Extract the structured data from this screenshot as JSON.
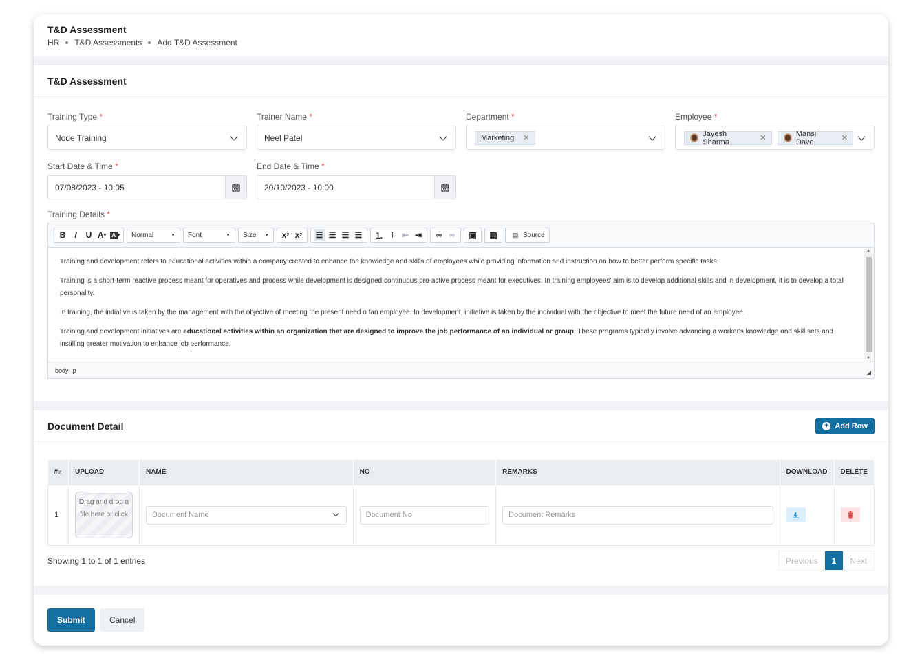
{
  "header": {
    "title": "T&D Assessment",
    "breadcrumb": [
      "HR",
      "T&D Assessments",
      "Add T&D Assessment"
    ]
  },
  "assessment": {
    "title": "T&D Assessment",
    "training_type": {
      "label": "Training Type",
      "value": "Node Training"
    },
    "trainer_name": {
      "label": "Trainer Name",
      "value": "Neel Patel"
    },
    "department": {
      "label": "Department",
      "tags": [
        "Marketing"
      ]
    },
    "employee": {
      "label": "Employee",
      "tags": [
        "Jayesh Sharma",
        "Mansi Dave"
      ]
    },
    "start_date": {
      "label": "Start Date & Time",
      "value": "07/08/2023 - 10:05"
    },
    "end_date": {
      "label": "End Date & Time",
      "value": "20/10/2023 - 10:00"
    },
    "details_label": "Training Details",
    "required_mark": "*"
  },
  "editor": {
    "toolbar": {
      "format": "Normal",
      "font": "Font",
      "size": "Size",
      "source": "Source"
    },
    "paragraphs": [
      "Training and development refers to educational activities within a company created to enhance the knowledge and skills of employees while providing information and instruction on how to better perform specific tasks.",
      "Training is a short-term reactive process meant for operatives and process while development is designed continuous pro-active process meant for executives. In training employees' aim is to develop additional skills and in development, it is to develop a total personality.",
      "In training, the initiative is taken by the management with the objective of meeting the present need o fan employee. In development, initiative is taken by the individual with the objective to meet the future need of an employee."
    ],
    "p4_start": "Training and development initiatives are ",
    "p4_bold": "educational activities within an organization that are designed to improve the job performance of an individual or group",
    "p4_end": ". These programs typically involve advancing a worker's knowledge and skill sets and instilling greater motivation to enhance job performance.",
    "path": [
      "body",
      "p"
    ]
  },
  "documents": {
    "title": "Document Detail",
    "add_row_label": "Add Row",
    "columns": {
      "num": "#",
      "upload": "UPLOAD",
      "name": "NAME",
      "no": "NO",
      "remarks": "REMARKS",
      "download": "DOWNLOAD",
      "delete": "DELETE"
    },
    "rows": [
      {
        "num": "1",
        "drop_text": "Drag and drop a file here or click",
        "name_placeholder": "Document Name",
        "no_placeholder": "Document No",
        "remarks_placeholder": "Document Remarks"
      }
    ],
    "showing": "Showing 1 to 1 of 1 entries",
    "pager": {
      "previous": "Previous",
      "current": "1",
      "next": "Next"
    }
  },
  "footer": {
    "submit_label": "Submit",
    "cancel_label": "Cancel"
  },
  "colors": {
    "primary": "#136fa1",
    "required": "#e24a4a",
    "download_bg": "#dbeefb",
    "delete_bg": "#fde3e3"
  }
}
